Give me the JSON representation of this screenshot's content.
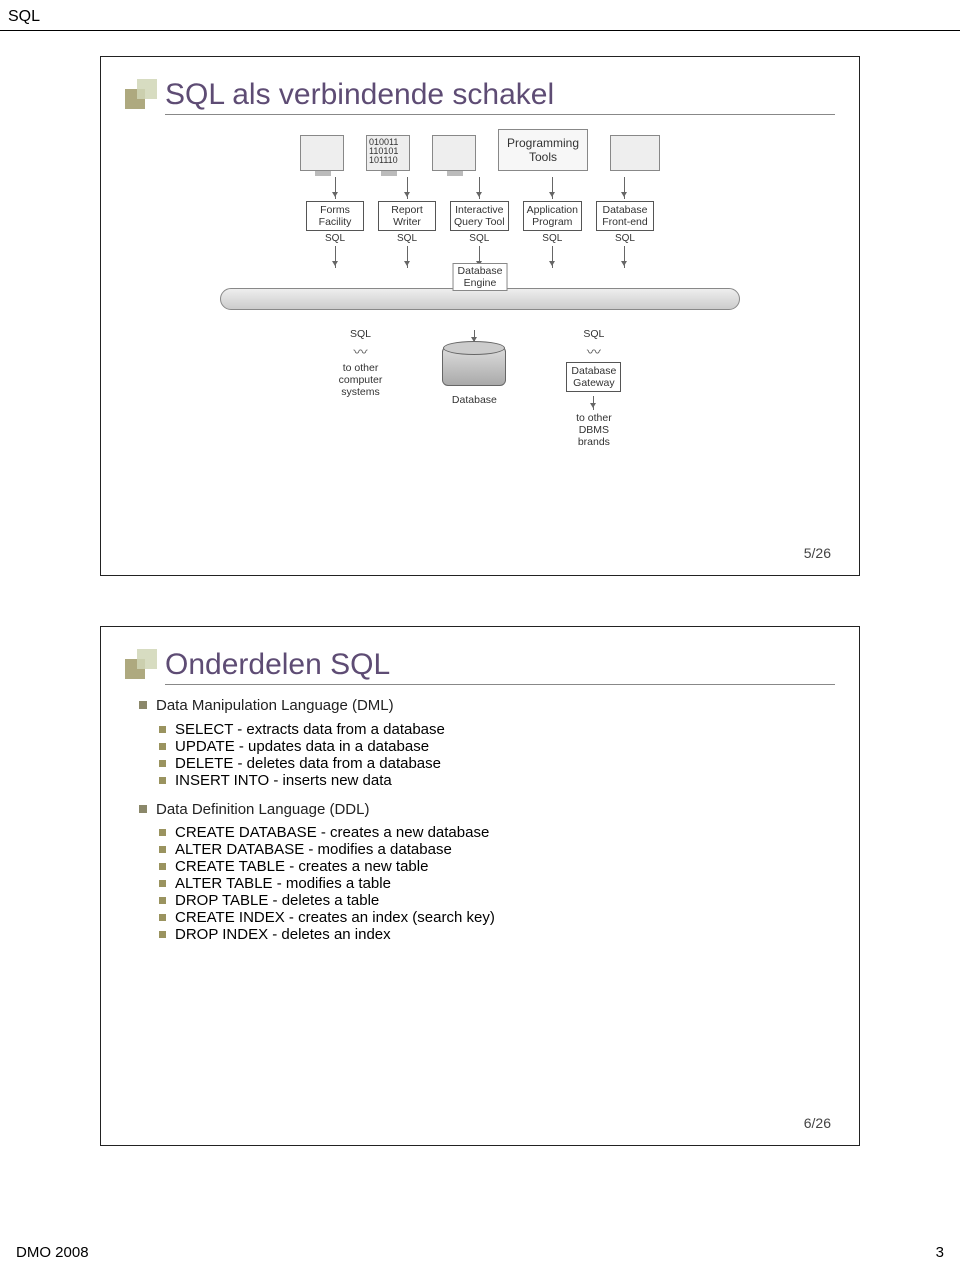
{
  "doc_header": "SQL",
  "footer_left": "DMO 2008",
  "footer_right": "3",
  "slide1": {
    "title": "SQL als verbindende schakel",
    "page_num": "5/26",
    "diagram": {
      "binary": "010011\n110101\n101110",
      "prog_tools": "Programming\nTools",
      "boxes": [
        "Forms\nFacility",
        "Report\nWriter",
        "Interactive\nQuery Tool",
        "Application\nProgram",
        "Database\nFront-end"
      ],
      "sql_label": "SQL",
      "engine": "Database\nEngine",
      "to_other_sys": "to other\ncomputer\nsystems",
      "database": "Database",
      "gateway": "Database\nGateway",
      "to_other_dbms": "to other\nDBMS\nbrands"
    }
  },
  "slide2": {
    "title": "Onderdelen SQL",
    "page_num": "6/26",
    "dml_heading": "Data Manipulation Language (DML)",
    "dml_items": [
      "SELECT - extracts data from a database",
      "UPDATE - updates data in a database",
      "DELETE - deletes data from a database",
      "INSERT INTO - inserts new data"
    ],
    "ddl_heading": "Data Definition Language (DDL)",
    "ddl_items": [
      "CREATE DATABASE - creates a new database",
      "ALTER DATABASE - modifies a database",
      "CREATE TABLE - creates a new table",
      "ALTER TABLE - modifies a table",
      "DROP TABLE - deletes a table",
      "CREATE INDEX - creates an index (search key)",
      "DROP INDEX - deletes an index"
    ]
  }
}
